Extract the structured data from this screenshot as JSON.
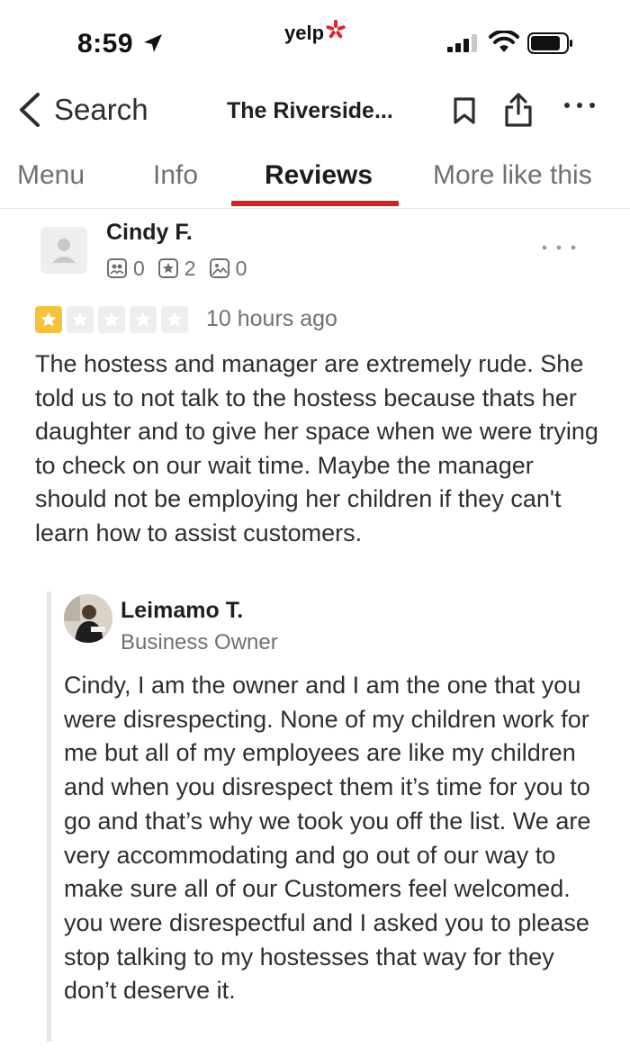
{
  "status_bar": {
    "time": "8:59",
    "center_logo": "yelp",
    "icons": [
      "location-arrow-icon",
      "yelp-burst-icon",
      "signal-icon",
      "wifi-icon",
      "battery-icon"
    ]
  },
  "nav": {
    "back_label": "Search",
    "title": "The Riverside...",
    "icons": [
      "chevron-left-icon",
      "bookmark-icon",
      "share-icon",
      "more-horizontal-icon"
    ]
  },
  "tabs": [
    {
      "label": "Menu",
      "active": false
    },
    {
      "label": "Info",
      "active": false
    },
    {
      "label": "Reviews",
      "active": true
    },
    {
      "label": "More like this",
      "active": false
    }
  ],
  "colors": {
    "accent_red": "#d32323",
    "star_yellow": "#f5c33b",
    "star_empty": "#eeeeef",
    "muted_text": "#6e7072"
  },
  "review": {
    "author": "Cindy F.",
    "stats": {
      "friends": "0",
      "reviews": "2",
      "photos": "0"
    },
    "rating": 1,
    "rating_max": 5,
    "time_ago": "10 hours ago",
    "text": "The hostess and manager are extremely rude. She told us to not talk to the hostess because thats her daughter and to give her space when we were trying to check on our wait time. Maybe the manager should not be employing her children if they can't learn how to assist customers."
  },
  "owner_reply": {
    "author": "Leimamo T.",
    "role": "Business Owner",
    "text": "Cindy, I am the owner and I am the one that you were disrespecting. None of my children work for me but all of my employees are like my children and when you disrespect them it’s time for you to go and that’s why we took you off the list. We are very accommodating and go out of our way to make sure all of our Customers feel welcomed. you were disrespectful and I asked you to please stop talking to my hostesses that way for they don’t deserve it."
  }
}
